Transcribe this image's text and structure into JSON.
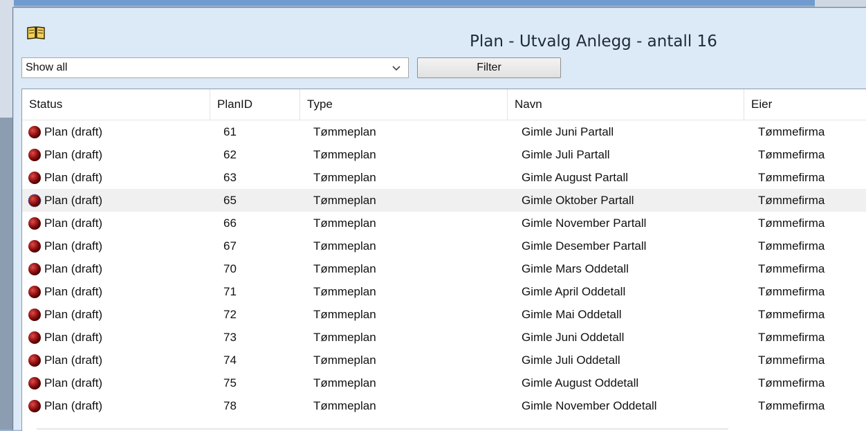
{
  "window": {
    "title": "Plan - Utvalg Anlegg - antall 16",
    "icon": "book-icon"
  },
  "toolbar": {
    "filter_select_value": "Show all",
    "filter_button_label": "Filter"
  },
  "table": {
    "columns": [
      "Status",
      "PlanID",
      "Type",
      "Navn",
      "Eier"
    ],
    "rows": [
      {
        "status": "Plan (draft)",
        "planid": "61",
        "type": "Tømmeplan",
        "navn": "Gimle Juni Partall",
        "eier": "Tømmefirma"
      },
      {
        "status": "Plan (draft)",
        "planid": "62",
        "type": "Tømmeplan",
        "navn": "Gimle Juli Partall",
        "eier": "Tømmefirma"
      },
      {
        "status": "Plan (draft)",
        "planid": "63",
        "type": "Tømmeplan",
        "navn": "Gimle August Partall",
        "eier": "Tømmefirma"
      },
      {
        "status": "Plan (draft)",
        "planid": "65",
        "type": "Tømmeplan",
        "navn": "Gimle Oktober Partall",
        "eier": "Tømmefirma"
      },
      {
        "status": "Plan (draft)",
        "planid": "66",
        "type": "Tømmeplan",
        "navn": "Gimle November Partall",
        "eier": "Tømmefirma"
      },
      {
        "status": "Plan (draft)",
        "planid": "67",
        "type": "Tømmeplan",
        "navn": "Gimle Desember Partall",
        "eier": "Tømmefirma"
      },
      {
        "status": "Plan (draft)",
        "planid": "70",
        "type": "Tømmeplan",
        "navn": "Gimle Mars Oddetall",
        "eier": "Tømmefirma"
      },
      {
        "status": "Plan (draft)",
        "planid": "71",
        "type": "Tømmeplan",
        "navn": "Gimle April Oddetall",
        "eier": "Tømmefirma"
      },
      {
        "status": "Plan (draft)",
        "planid": "72",
        "type": "Tømmeplan",
        "navn": "Gimle Mai Oddetall",
        "eier": "Tømmefirma"
      },
      {
        "status": "Plan (draft)",
        "planid": "73",
        "type": "Tømmeplan",
        "navn": "Gimle Juni Oddetall",
        "eier": "Tømmefirma"
      },
      {
        "status": "Plan (draft)",
        "planid": "74",
        "type": "Tømmeplan",
        "navn": "Gimle Juli Oddetall",
        "eier": "Tømmefirma"
      },
      {
        "status": "Plan (draft)",
        "planid": "75",
        "type": "Tømmeplan",
        "navn": "Gimle August Oddetall",
        "eier": "Tømmefirma"
      },
      {
        "status": "Plan (draft)",
        "planid": "78",
        "type": "Tømmeplan",
        "navn": "Gimle November Oddetall",
        "eier": "Tømmefirma"
      }
    ],
    "selected_row_index": 3
  },
  "colors": {
    "status_dot": "#8b0d0d",
    "selected_row_bg": "#f0f0f0"
  }
}
